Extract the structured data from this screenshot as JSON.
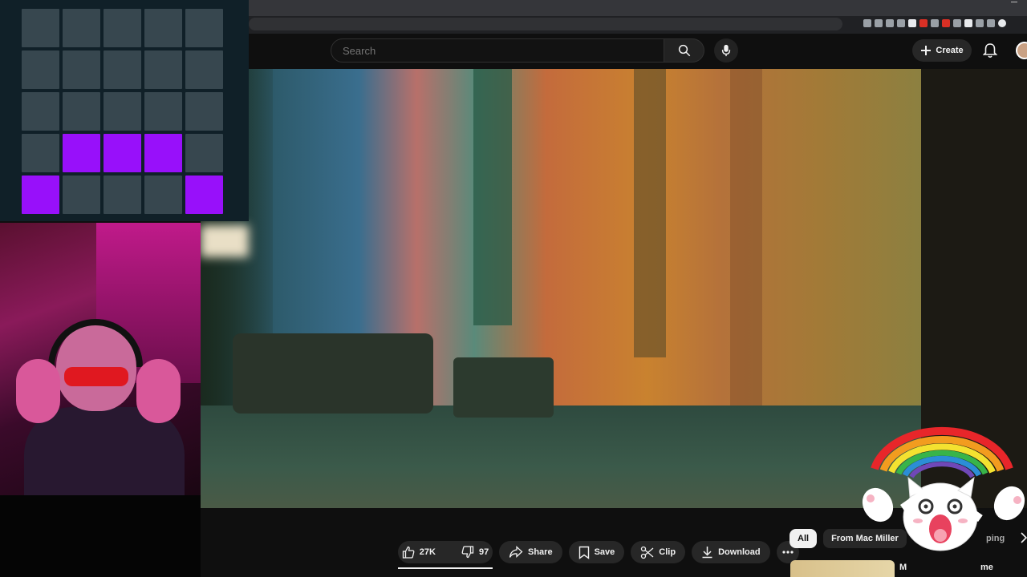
{
  "browser": {
    "extension_icons": [
      "ext-icon",
      "ext-icon",
      "ext-icon",
      "ext-icon",
      "ext-icon",
      "ext-icon",
      "ext-icon",
      "ext-icon",
      "ext-icon",
      "ext-icon",
      "ext-icon",
      "ext-icon",
      "ext-icon",
      "profile-icon"
    ]
  },
  "header": {
    "search_placeholder": "Search",
    "create_label": "Create",
    "icons": [
      "search-icon",
      "mic-icon",
      "plus-icon",
      "bell-icon",
      "avatar"
    ]
  },
  "grid_overlay": {
    "rows": 5,
    "cols": 5,
    "active_color": "#9810fa",
    "inactive_color": "#37474f",
    "active_cells": [
      [
        3,
        1
      ],
      [
        3,
        2
      ],
      [
        3,
        3
      ],
      [
        4,
        0
      ],
      [
        4,
        4
      ]
    ]
  },
  "actions": {
    "likes": "27K",
    "dislikes": "97",
    "share": "Share",
    "save": "Save",
    "clip": "Clip",
    "download": "Download"
  },
  "chips": {
    "items": [
      "All",
      "From Mac Miller"
    ],
    "partial": "ping"
  },
  "related": {
    "title_fragment_a": "M",
    "title_fragment_b": "me"
  },
  "colors": {
    "background": "#0f0f0f",
    "pill": "#272727",
    "text": "#f1f1f1"
  }
}
